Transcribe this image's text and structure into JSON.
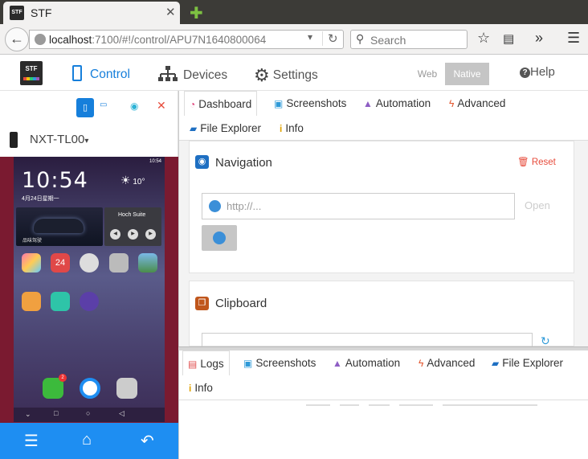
{
  "browser": {
    "tab_title": "STF",
    "url_host": "localhost",
    "url_rest": ":7100/#!/control/APU7N1640800064",
    "search_placeholder": "Search"
  },
  "header": {
    "logo_text": "STF",
    "nav": [
      {
        "label": "Control",
        "icon": "phone-icon",
        "active": true
      },
      {
        "label": "Devices",
        "icon": "sitemap-icon",
        "active": false
      },
      {
        "label": "Settings",
        "icon": "gears-icon",
        "active": false
      }
    ],
    "mode_web": "Web",
    "mode_native": "Native",
    "help": "Help"
  },
  "device": {
    "name": "NXT-TL00",
    "screen": {
      "time": "10:54",
      "date": "4月24日星期一",
      "weather": "10°",
      "music_title": "Hoch Suite",
      "car_label": "品味驾驶",
      "status_time": "10:54",
      "badge_count": "2",
      "calendar_day": "24"
    }
  },
  "top_tabs": [
    {
      "label": "Dashboard",
      "icon": "dashboard-icon",
      "color": "#e0457b"
    },
    {
      "label": "Screenshots",
      "icon": "camera-icon",
      "color": "#2f9ad8"
    },
    {
      "label": "Automation",
      "icon": "automation-icon",
      "color": "#8e5ec4"
    },
    {
      "label": "Advanced",
      "icon": "bolt-icon",
      "color": "#e2542b"
    },
    {
      "label": "File Explorer",
      "icon": "folder-icon",
      "color": "#1e6fc2"
    },
    {
      "label": "Info",
      "icon": "info-icon",
      "color": "#e0a200"
    }
  ],
  "navigation_panel": {
    "title": "Navigation",
    "reset": "Reset",
    "url_placeholder": "http://...",
    "open": "Open"
  },
  "clipboard_panel": {
    "title": "Clipboard"
  },
  "bottom_tabs": [
    {
      "label": "Logs",
      "icon": "list-icon",
      "color": "#e05050"
    },
    {
      "label": "Screenshots",
      "icon": "camera-icon",
      "color": "#2f9ad8"
    },
    {
      "label": "Automation",
      "icon": "automation-icon",
      "color": "#8e5ec4"
    },
    {
      "label": "Advanced",
      "icon": "bolt-icon",
      "color": "#e2542b"
    },
    {
      "label": "File Explorer",
      "icon": "folder-icon",
      "color": "#1e6fc2"
    },
    {
      "label": "Info",
      "icon": "info-icon",
      "color": "#e0a200"
    }
  ]
}
